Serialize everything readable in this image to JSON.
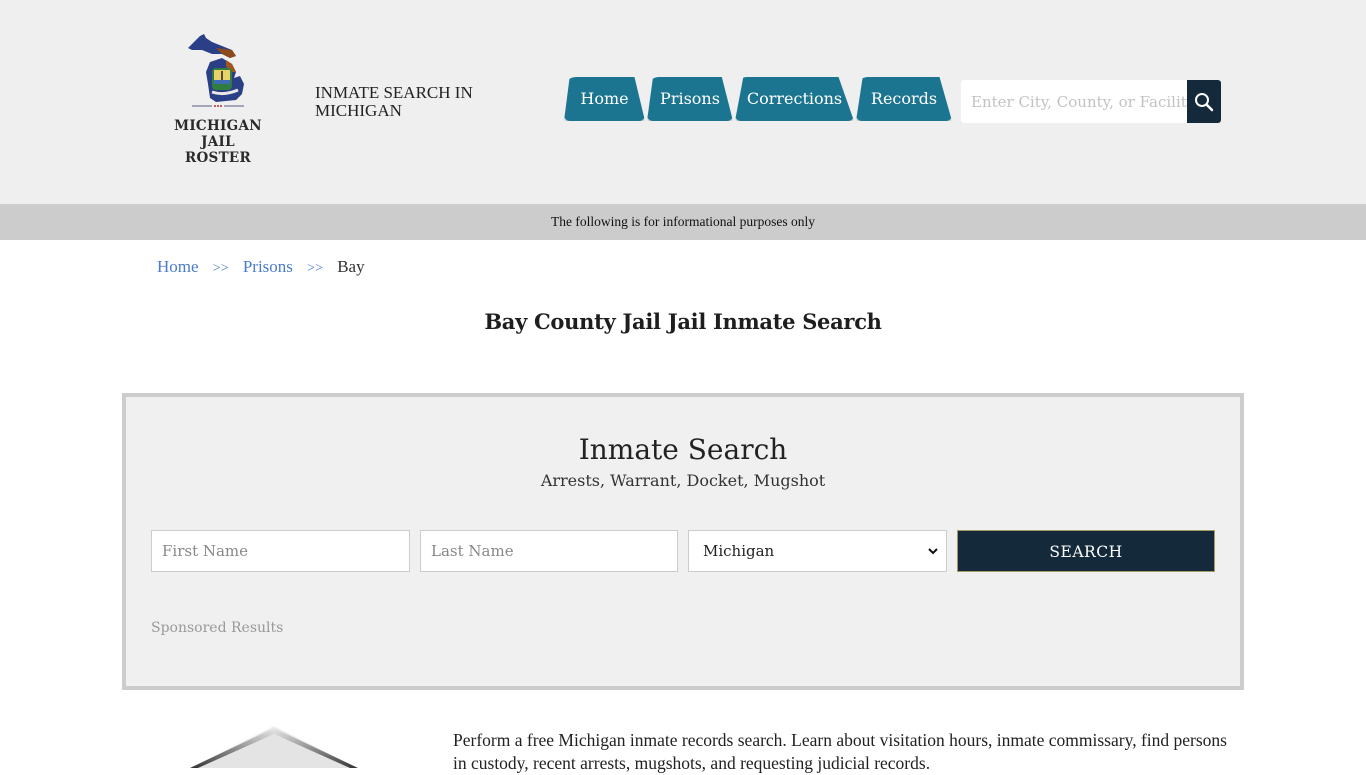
{
  "header": {
    "logo": {
      "line1": "MICHIGAN",
      "line2": "JAIL ROSTER",
      "icon": "michigan-map-icon"
    },
    "tagline": "INMATE SEARCH IN MICHIGAN",
    "nav": [
      {
        "label": "Home"
      },
      {
        "label": "Prisons"
      },
      {
        "label": "Corrections"
      },
      {
        "label": "Records"
      }
    ],
    "search": {
      "placeholder": "Enter City, County, or Facility",
      "value": "",
      "icon": "search-icon"
    },
    "colors": {
      "nav_bg": "#1b7590",
      "search_btn_bg": "#142a3a",
      "header_bg": "#efefef"
    }
  },
  "info_bar": {
    "text": "The following is for informational purposes only",
    "bg": "#cccccc"
  },
  "breadcrumb": {
    "items": [
      {
        "label": "Home"
      },
      {
        "label": "Prisons"
      }
    ],
    "separator": ">>",
    "current": "Bay"
  },
  "page_title": "Bay County Jail Jail Inmate Search",
  "search_panel": {
    "title": "Inmate Search",
    "subtitle": "Arrests, Warrant, Docket, Mugshot",
    "first_name": {
      "placeholder": "First Name",
      "value": ""
    },
    "last_name": {
      "placeholder": "Last Name",
      "value": ""
    },
    "state": {
      "selected": "Michigan"
    },
    "submit_label": "SEARCH",
    "sponsored_label": "Sponsored Results"
  },
  "intro": {
    "text": "Perform a free Michigan inmate records search. Learn about visitation hours, inmate commissary, find persons in custody, recent arrests, mugshots, and requesting judicial records."
  }
}
